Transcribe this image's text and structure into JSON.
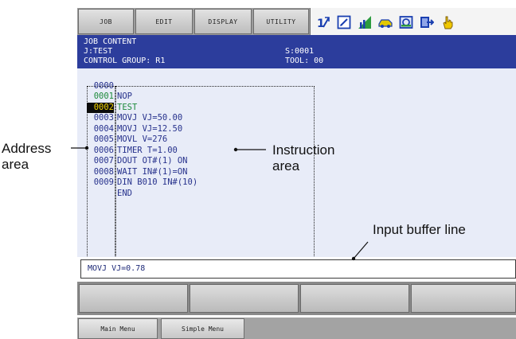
{
  "menu": {
    "items": [
      "JOB",
      "EDIT",
      "DISPLAY",
      "UTILITY"
    ]
  },
  "status_icons": [
    "robot-axis-icon",
    "edit-mode-icon",
    "signal-level-icon",
    "car-icon",
    "servo-icon",
    "arrow-exit-icon",
    "hand-cursor-icon"
  ],
  "header": {
    "title": "JOB CONTENT",
    "job": "J:TEST",
    "step": "S:0001",
    "control_group": "CONTROL GROUP: R1",
    "tool": "TOOL: 00"
  },
  "job_lines": [
    {
      "addr": "0000",
      "instr": "NOP"
    },
    {
      "addr": "0001",
      "instr": "TEST"
    },
    {
      "addr": "0002",
      "instr": "MOVJ VJ=50.00"
    },
    {
      "addr": "0003",
      "instr": "MOVJ VJ=12.50"
    },
    {
      "addr": "0004",
      "instr": "MOVL V=276"
    },
    {
      "addr": "0005",
      "instr": "TIMER T=1.00"
    },
    {
      "addr": "0006",
      "instr": "DOUT OT#(1) ON"
    },
    {
      "addr": "0007",
      "instr": "WAIT IN#(1)=ON"
    },
    {
      "addr": "0008",
      "instr": "DIN B010 IN#(10)"
    },
    {
      "addr": "0009",
      "instr": "END"
    }
  ],
  "selected_line": "0002",
  "input_buffer": "MOVJ VJ=0.78",
  "bottom_menu": {
    "main_menu": "Main Menu",
    "simple_menu": "Simple Menu"
  },
  "annotations": {
    "address_area": "Address area",
    "instruction_area": "Instruction area",
    "input_buffer_line": "Input buffer line"
  },
  "colors": {
    "header_bg": "#2c3d9c",
    "text_blue": "#26318c",
    "comment_green": "#1d8a3b",
    "cursor_bg": "#0c0c0c",
    "cursor_fg": "#f2d400"
  }
}
